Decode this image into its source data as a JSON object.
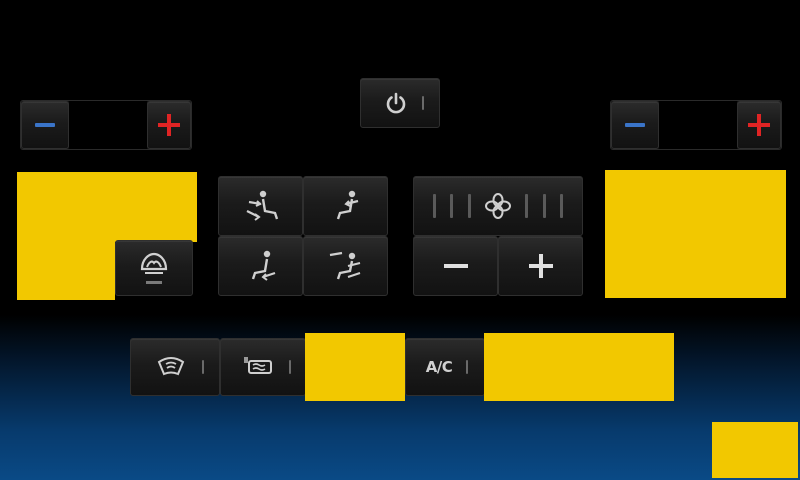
{
  "power": {
    "icon": "power-icon"
  },
  "left_temp": {
    "minus_icon": "minus-icon",
    "plus_icon": "plus-icon",
    "value": ""
  },
  "right_temp": {
    "minus_icon": "minus-icon",
    "plus_icon": "plus-icon",
    "value": ""
  },
  "airflow_modes": [
    {
      "icon": "airflow-face-feet-icon"
    },
    {
      "icon": "airflow-face-icon"
    },
    {
      "icon": "airflow-feet-icon"
    },
    {
      "icon": "airflow-windshield-feet-icon"
    }
  ],
  "fan": {
    "icon": "fan-icon",
    "level": 0,
    "segments": 6,
    "minus_icon": "minus-icon",
    "plus_icon": "plus-icon"
  },
  "seat": {
    "icon": "seat-climate-icon"
  },
  "bottom_controls": {
    "front_defrost_icon": "front-defrost-icon",
    "rear_defrost_icon": "rear-defrost-icon",
    "ac_label": "A/C"
  },
  "colors": {
    "placeholder": "#f2c800",
    "minus": "#3a74c8",
    "plus": "#e02424",
    "background_bottom": "#0a4a86"
  }
}
